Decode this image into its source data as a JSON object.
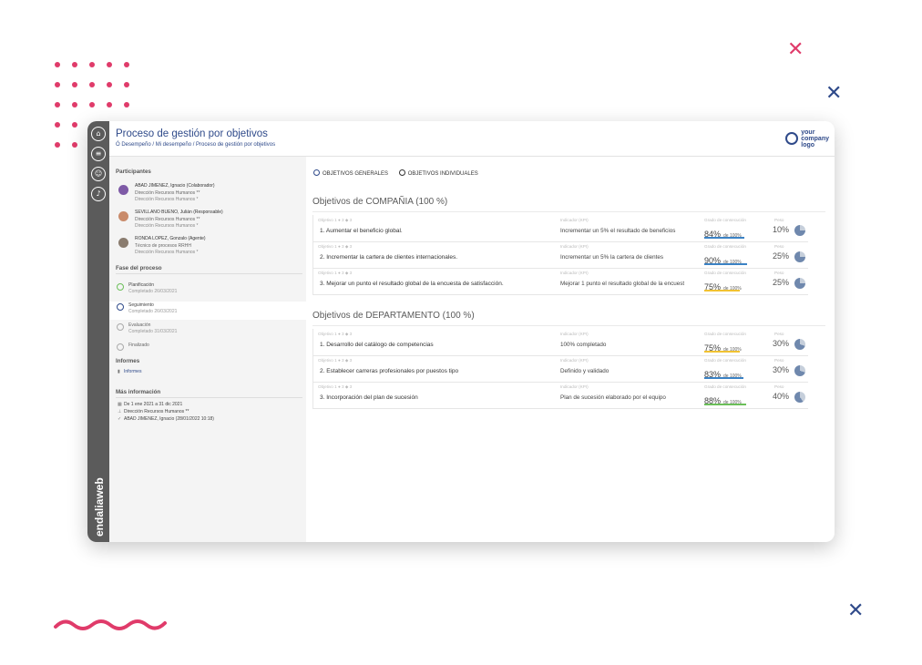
{
  "app": {
    "title": "Proceso de gestión por objetivos",
    "breadcrumb": "Ó  Desempeño  /  Mi desempeño  /  Proceso de gestión por objetivos",
    "logo_line1": "your",
    "logo_line2": "company",
    "logo_line3": "logo",
    "brand": "endaliaweb"
  },
  "colors": {
    "accent": "#2f4a8a",
    "pink": "#e03b6a",
    "rail": "#5b5b5b",
    "bar_blue": "#3b82c4",
    "bar_yellow": "#f1c232",
    "bar_green": "#6bbf59"
  },
  "rail_icons": [
    "home-icon",
    "menu-icon",
    "user-icon",
    "bell-icon"
  ],
  "sidebar": {
    "participants_title": "Participantes",
    "participants": [
      {
        "name": "ABAD JIMENEZ, Ignacio (Colaborador)",
        "role": "Dirección Recursos Humanos **",
        "dept": "Dirección Recursos Humanos *"
      },
      {
        "name": "SEVILLANO BUENO, Julián (Responsable)",
        "role": "Dirección Recursos Humanos **",
        "dept": "Dirección Recursos Humanos *"
      },
      {
        "name": "RONDA LOPEZ, Gonzalo (Agente)",
        "role": "Técnico de procesos RRHH",
        "dept": "Dirección Recursos Humanos *"
      }
    ],
    "stages_title": "Fase del proceso",
    "stages": [
      {
        "name": "Planificación",
        "date": "Completado 26/03/2021"
      },
      {
        "name": "Seguimiento",
        "date": "Completado 26/03/2021"
      },
      {
        "name": "Evaluación",
        "date": "Completado 31/03/2021"
      },
      {
        "name": "Finalizado",
        "date": ""
      }
    ],
    "reports_title": "Informes",
    "reports_link": "Informes",
    "more_title": "Más información",
    "more": [
      "De 1 ene 2021 a 31 dic 2021",
      "Dirección Recursos Humanos **",
      "ABAD JIMENEZ, Ignacio (28/01/2022 10:18)"
    ]
  },
  "tabs": [
    "OBJETIVOS GENERALES",
    "OBJETIVOS INDIVIDUALES"
  ],
  "meta_text": "Objetivo 1    ● 3   ◆ 3",
  "labels": {
    "indicator": "Indicador (KPI)",
    "achievement": "Grado de consecución",
    "weight": "Peso",
    "of": "de 100%"
  },
  "sections": [
    {
      "title": "Objetivos de COMPAÑIA (100 %)",
      "objectives": [
        {
          "name": "1. Aumentar el beneficio global.",
          "indicator": "Incrementar un 5% el resultado de beneficios",
          "achievement": "84%",
          "progress": 84,
          "bar": "blue",
          "weight": "10%",
          "share": 10
        },
        {
          "name": "2. Incrementar la cartera de clientes internacionales.",
          "indicator": "Incrementar un 5% la cartera de clientes",
          "achievement": "90%",
          "progress": 90,
          "bar": "blue",
          "weight": "25%",
          "share": 25
        },
        {
          "name": "3. Mejorar un punto el resultado global de la encuesta de satisfacción.",
          "indicator": "Mejorar 1 punto el resultado global de la encuesta",
          "achievement": "75%",
          "progress": 75,
          "bar": "yellow",
          "weight": "25%",
          "share": 25
        }
      ]
    },
    {
      "title": "Objetivos de DEPARTAMENTO (100 %)",
      "objectives": [
        {
          "name": "1. Desarrollo del catálogo de competencias",
          "indicator": "100% completado",
          "achievement": "75%",
          "progress": 75,
          "bar": "yellow",
          "weight": "30%",
          "share": 30
        },
        {
          "name": "2. Establecer carreras profesionales por puestos tipo",
          "indicator": "Definido y validado",
          "achievement": "83%",
          "progress": 83,
          "bar": "blue",
          "weight": "30%",
          "share": 30
        },
        {
          "name": "3. Incorporación del plan de sucesión",
          "indicator": "Plan de sucesión elaborado por el equipo",
          "achievement": "88%",
          "progress": 88,
          "bar": "green",
          "weight": "40%",
          "share": 40
        }
      ]
    }
  ]
}
